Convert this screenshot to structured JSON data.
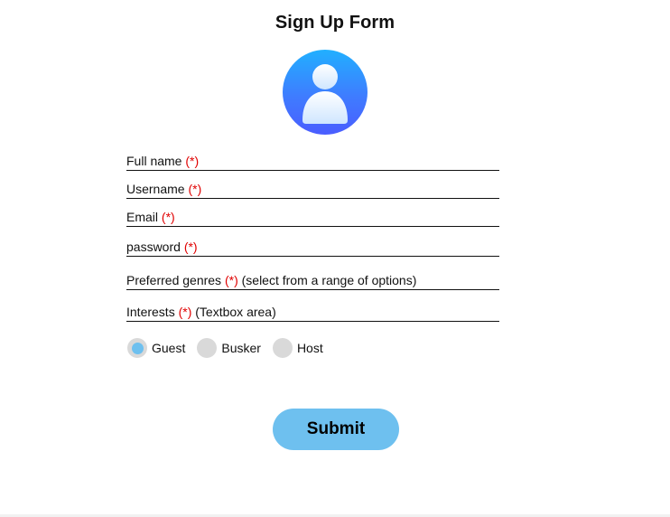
{
  "form": {
    "title": "Sign Up Form",
    "avatar_icon": "user-avatar-icon",
    "required_marker": "(*)",
    "fields": [
      {
        "label": "Full name",
        "suffix": ""
      },
      {
        "label": "Username",
        "suffix": ""
      },
      {
        "label": "Email",
        "suffix": ""
      },
      {
        "label": "password",
        "suffix": ""
      },
      {
        "label": "Preferred genres",
        "suffix": "(select from a range of options)"
      },
      {
        "label": "Interests",
        "suffix": "(Textbox area)"
      }
    ],
    "roles": [
      {
        "label": "Guest",
        "selected": true
      },
      {
        "label": "Busker",
        "selected": false
      },
      {
        "label": "Host",
        "selected": false
      }
    ],
    "submit_label": "Submit"
  },
  "colors": {
    "required": "#e00000",
    "accent": "#6ec0ef",
    "radio_unselected": "#d9d9d9",
    "avatar_top": "#21b0ff",
    "avatar_bottom": "#4a5dff"
  }
}
